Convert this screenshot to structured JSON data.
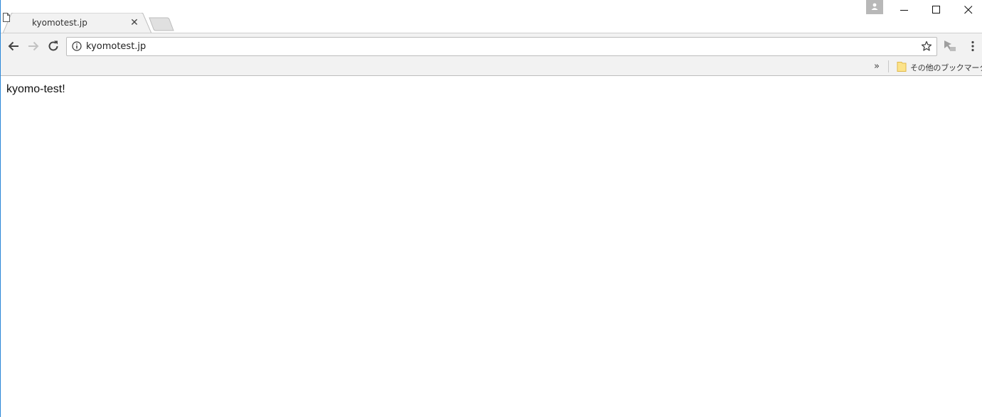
{
  "window": {
    "tabs": [
      {
        "title": "kyomotest.jp",
        "active": true
      }
    ],
    "icons": {
      "profile": "profile-icon",
      "minimize": "minimize-icon",
      "maximize": "maximize-icon",
      "close": "close-icon"
    }
  },
  "toolbar": {
    "url": "kyomotest.jp",
    "icons": [
      "back-arrow-icon",
      "forward-arrow-icon",
      "reload-icon",
      "info-icon",
      "star-icon",
      "extension-icon",
      "menu-icon"
    ],
    "forward_enabled": false
  },
  "bookmarks_bar": {
    "overflow": "»",
    "other_bookmarks": "その他のブックマーク"
  },
  "page": {
    "body_text": "kyomo-test!"
  },
  "colors": {
    "toolbar_bg": "#f2f2f2",
    "window_edge": "#2b87d8"
  }
}
